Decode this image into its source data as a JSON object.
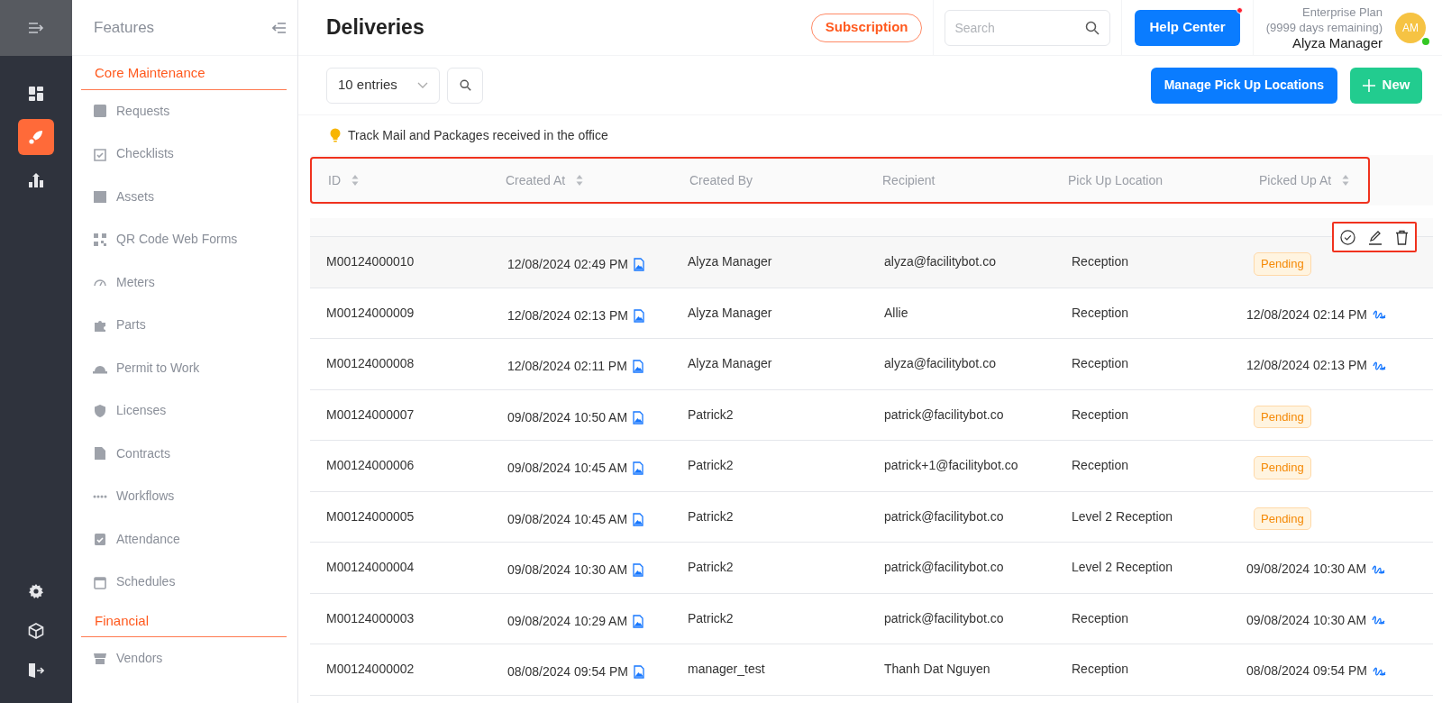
{
  "rail": {
    "top": [
      {
        "selected": false
      },
      {
        "selected": true
      },
      {
        "selected": false
      }
    ],
    "bottom": [
      {
        "selected": false
      },
      {
        "selected": false
      },
      {
        "selected": false
      }
    ]
  },
  "sidebar": {
    "title": "Features",
    "sections": [
      {
        "title": "Core Maintenance",
        "items": [
          "Requests",
          "Checklists",
          "Assets",
          "QR Code Web Forms",
          "Meters",
          "Parts",
          "Permit to Work",
          "Licenses",
          "Contracts",
          "Workflows",
          "Attendance",
          "Schedules"
        ]
      },
      {
        "title": "Financial",
        "items": [
          "Vendors"
        ]
      }
    ]
  },
  "header": {
    "title": "Deliveries",
    "subscription": "Subscription",
    "search": {
      "placeholder": "Search"
    },
    "help": {
      "label": "Help Center",
      "notification": true
    },
    "user": {
      "plan": "Enterprise Plan",
      "remaining": "(9999 days remaining)",
      "name": "Alyza Manager",
      "initials": "AM",
      "online": true
    }
  },
  "toolbar": {
    "entries": "10 entries",
    "manage": "Manage Pick Up Locations",
    "new": "New"
  },
  "hint": "Track Mail and Packages received in the office",
  "table": {
    "header_highlighted": true,
    "row_actions": {
      "highlighted": true
    },
    "columns": [
      {
        "label": "ID",
        "sortable": true
      },
      {
        "label": "Created At",
        "sortable": true
      },
      {
        "label": "Created By",
        "sortable": false
      },
      {
        "label": "Recipient",
        "sortable": false
      },
      {
        "label": "Pick Up Location",
        "sortable": false
      },
      {
        "label": "Picked Up At",
        "sortable": true
      }
    ],
    "rows": [
      {
        "id": "M00124000010",
        "created_at": "12/08/2024 02:49 PM",
        "created_by": "Alyza Manager",
        "recipient": "alyza@facilitybot.co",
        "location": "Reception",
        "picked_up": {
          "kind": "pending",
          "label": "Pending"
        },
        "hovered": true
      },
      {
        "id": "M00124000009",
        "created_at": "12/08/2024 02:13 PM",
        "created_by": "Alyza Manager",
        "recipient": "Allie",
        "location": "Reception",
        "picked_up": {
          "kind": "time",
          "label": "12/08/2024 02:14 PM"
        },
        "hovered": false
      },
      {
        "id": "M00124000008",
        "created_at": "12/08/2024 02:11 PM",
        "created_by": "Alyza Manager",
        "recipient": "alyza@facilitybot.co",
        "location": "Reception",
        "picked_up": {
          "kind": "time",
          "label": "12/08/2024 02:13 PM"
        },
        "hovered": false
      },
      {
        "id": "M00124000007",
        "created_at": "09/08/2024 10:50 AM",
        "created_by": "Patrick2",
        "recipient": "patrick@facilitybot.co",
        "location": "Reception",
        "picked_up": {
          "kind": "pending",
          "label": "Pending"
        },
        "hovered": false
      },
      {
        "id": "M00124000006",
        "created_at": "09/08/2024 10:45 AM",
        "created_by": "Patrick2",
        "recipient": "patrick+1@facilitybot.co",
        "location": "Reception",
        "picked_up": {
          "kind": "pending",
          "label": "Pending"
        },
        "hovered": false
      },
      {
        "id": "M00124000005",
        "created_at": "09/08/2024 10:45 AM",
        "created_by": "Patrick2",
        "recipient": "patrick@facilitybot.co",
        "location": "Level 2 Reception",
        "picked_up": {
          "kind": "pending",
          "label": "Pending"
        },
        "hovered": false
      },
      {
        "id": "M00124000004",
        "created_at": "09/08/2024 10:30 AM",
        "created_by": "Patrick2",
        "recipient": "patrick@facilitybot.co",
        "location": "Level 2 Reception",
        "picked_up": {
          "kind": "time",
          "label": "09/08/2024 10:30 AM"
        },
        "hovered": false
      },
      {
        "id": "M00124000003",
        "created_at": "09/08/2024 10:29 AM",
        "created_by": "Patrick2",
        "recipient": "patrick@facilitybot.co",
        "location": "Reception",
        "picked_up": {
          "kind": "time",
          "label": "09/08/2024 10:30 AM"
        },
        "hovered": false
      },
      {
        "id": "M00124000002",
        "created_at": "08/08/2024 09:54 PM",
        "created_by": "manager_test",
        "recipient": "Thanh Dat Nguyen",
        "location": "Reception",
        "picked_up": {
          "kind": "time",
          "label": "08/08/2024 09:54 PM"
        },
        "hovered": false
      }
    ]
  }
}
